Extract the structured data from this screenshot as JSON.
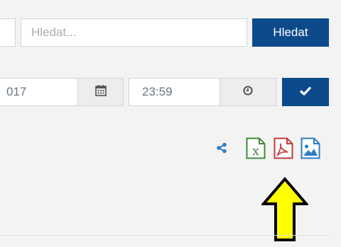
{
  "search": {
    "placeholder": "Hledat...",
    "button_label": "Hledat"
  },
  "date_time": {
    "date_value": "017",
    "time_value": "23:59"
  },
  "icons": {
    "calendar": "calendar-icon",
    "clock": "clock-icon",
    "confirm": "check-icon",
    "share": "share-icon",
    "excel": "excel-file-icon",
    "pdf": "pdf-file-icon",
    "image": "image-file-icon",
    "arrow": "up-arrow-annotation"
  },
  "colors": {
    "primary": "#0d4a8c",
    "excel": "#3f8a3c",
    "pdf": "#c23b3b",
    "image": "#2f7cc4",
    "arrow_fill": "#ffff00"
  }
}
